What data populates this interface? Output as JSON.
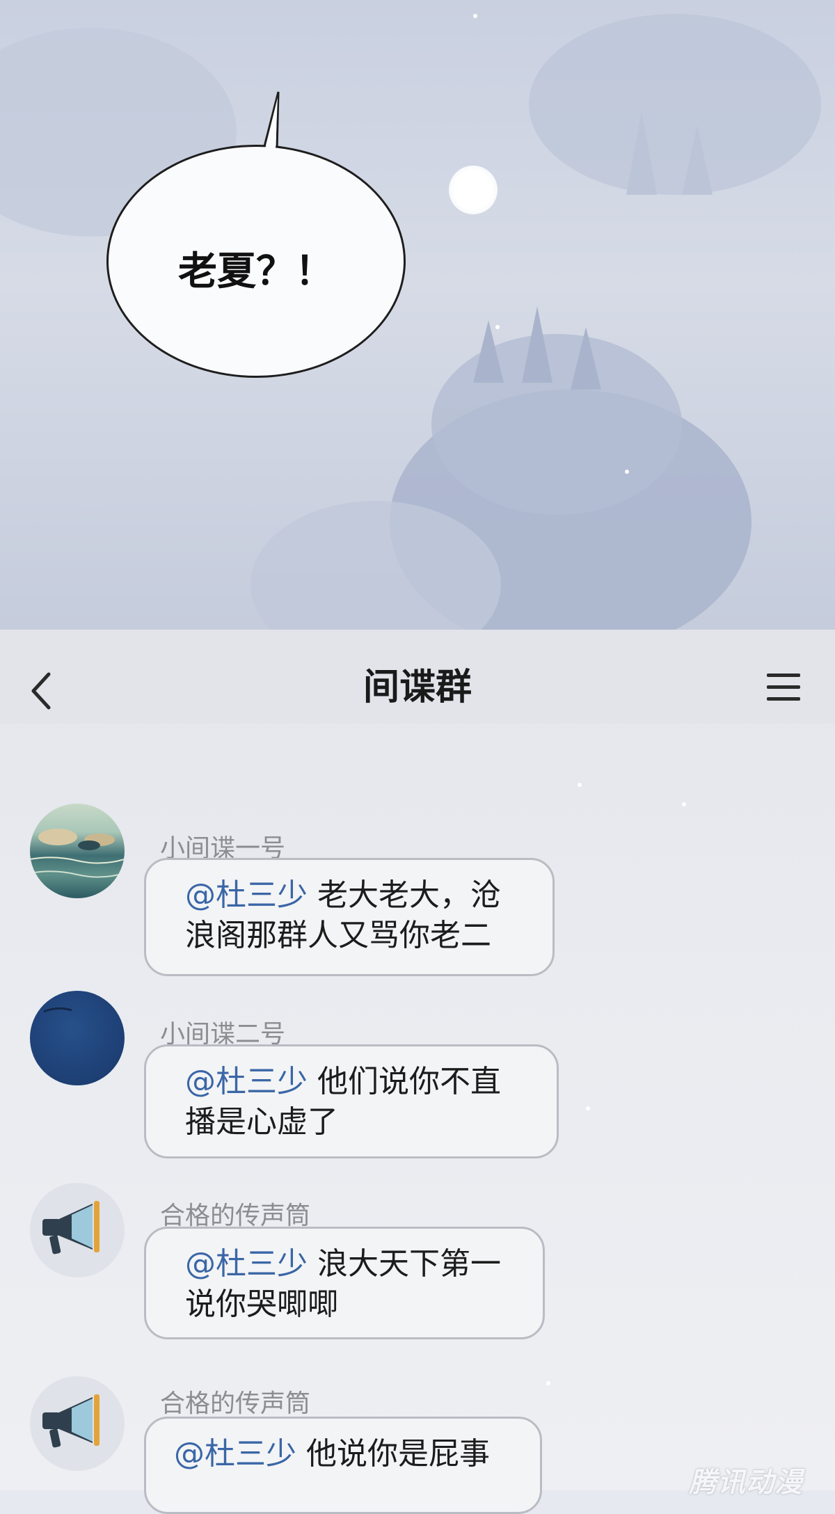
{
  "comic": {
    "speech_bubble": "老夏？！"
  },
  "header": {
    "title": "间谍群",
    "back_icon": "chevron-left-icon",
    "menu_icon": "menu-icon"
  },
  "messages": [
    {
      "sender": "小间谍一号",
      "mention": "@杜三少",
      "text_line1": "老大老大，沧",
      "text_line2": "浪阁那群人又骂你老二",
      "avatar": "ocean-rocks-avatar"
    },
    {
      "sender": "小间谍二号",
      "mention": "@杜三少",
      "text_line1": "他们说你不直",
      "text_line2": "播是心虚了",
      "avatar": "blue-circle-avatar"
    },
    {
      "sender": "合格的传声筒",
      "mention": "@杜三少",
      "text_line1": "浪大天下第一",
      "text_line2": "说你哭唧唧",
      "avatar": "megaphone-avatar"
    },
    {
      "sender": "合格的传声筒",
      "mention": "@杜三少",
      "text_line1": "他说你是屁事",
      "text_line2": "",
      "avatar": "megaphone-avatar"
    }
  ],
  "watermark": "腾讯动漫",
  "colors": {
    "mention": "#3a66a6",
    "bubble_border": "#b9bcc3",
    "sender_name": "#8b8d92"
  }
}
